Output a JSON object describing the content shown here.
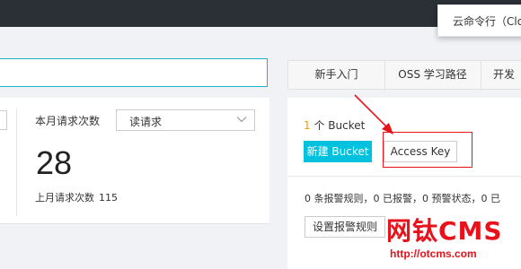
{
  "popover": {
    "text": "云命令行（Clo"
  },
  "usage": {
    "metric_label": "本月请求次数",
    "metric_select": "读请求",
    "value": "28",
    "last_month_label": "上月请求次数",
    "last_month_value": "115"
  },
  "tabs": [
    {
      "label": "新手入门"
    },
    {
      "label": "OSS 学习路径"
    },
    {
      "label": "开发"
    }
  ],
  "bucket": {
    "count": "1",
    "count_suffix": "个 Bucket",
    "create_label": "新建 Bucket",
    "access_key_label": "Access Key"
  },
  "alarm": {
    "summary": "0 条报警规则，0 已报警，0 预警状态，0 已",
    "settings_label": "设置报警规则"
  },
  "watermark": {
    "logo": "网钛CMS",
    "url": "http://otcms.com"
  },
  "colors": {
    "accent": "#00c1de",
    "highlight": "#e8121b",
    "count": "#f39800"
  }
}
